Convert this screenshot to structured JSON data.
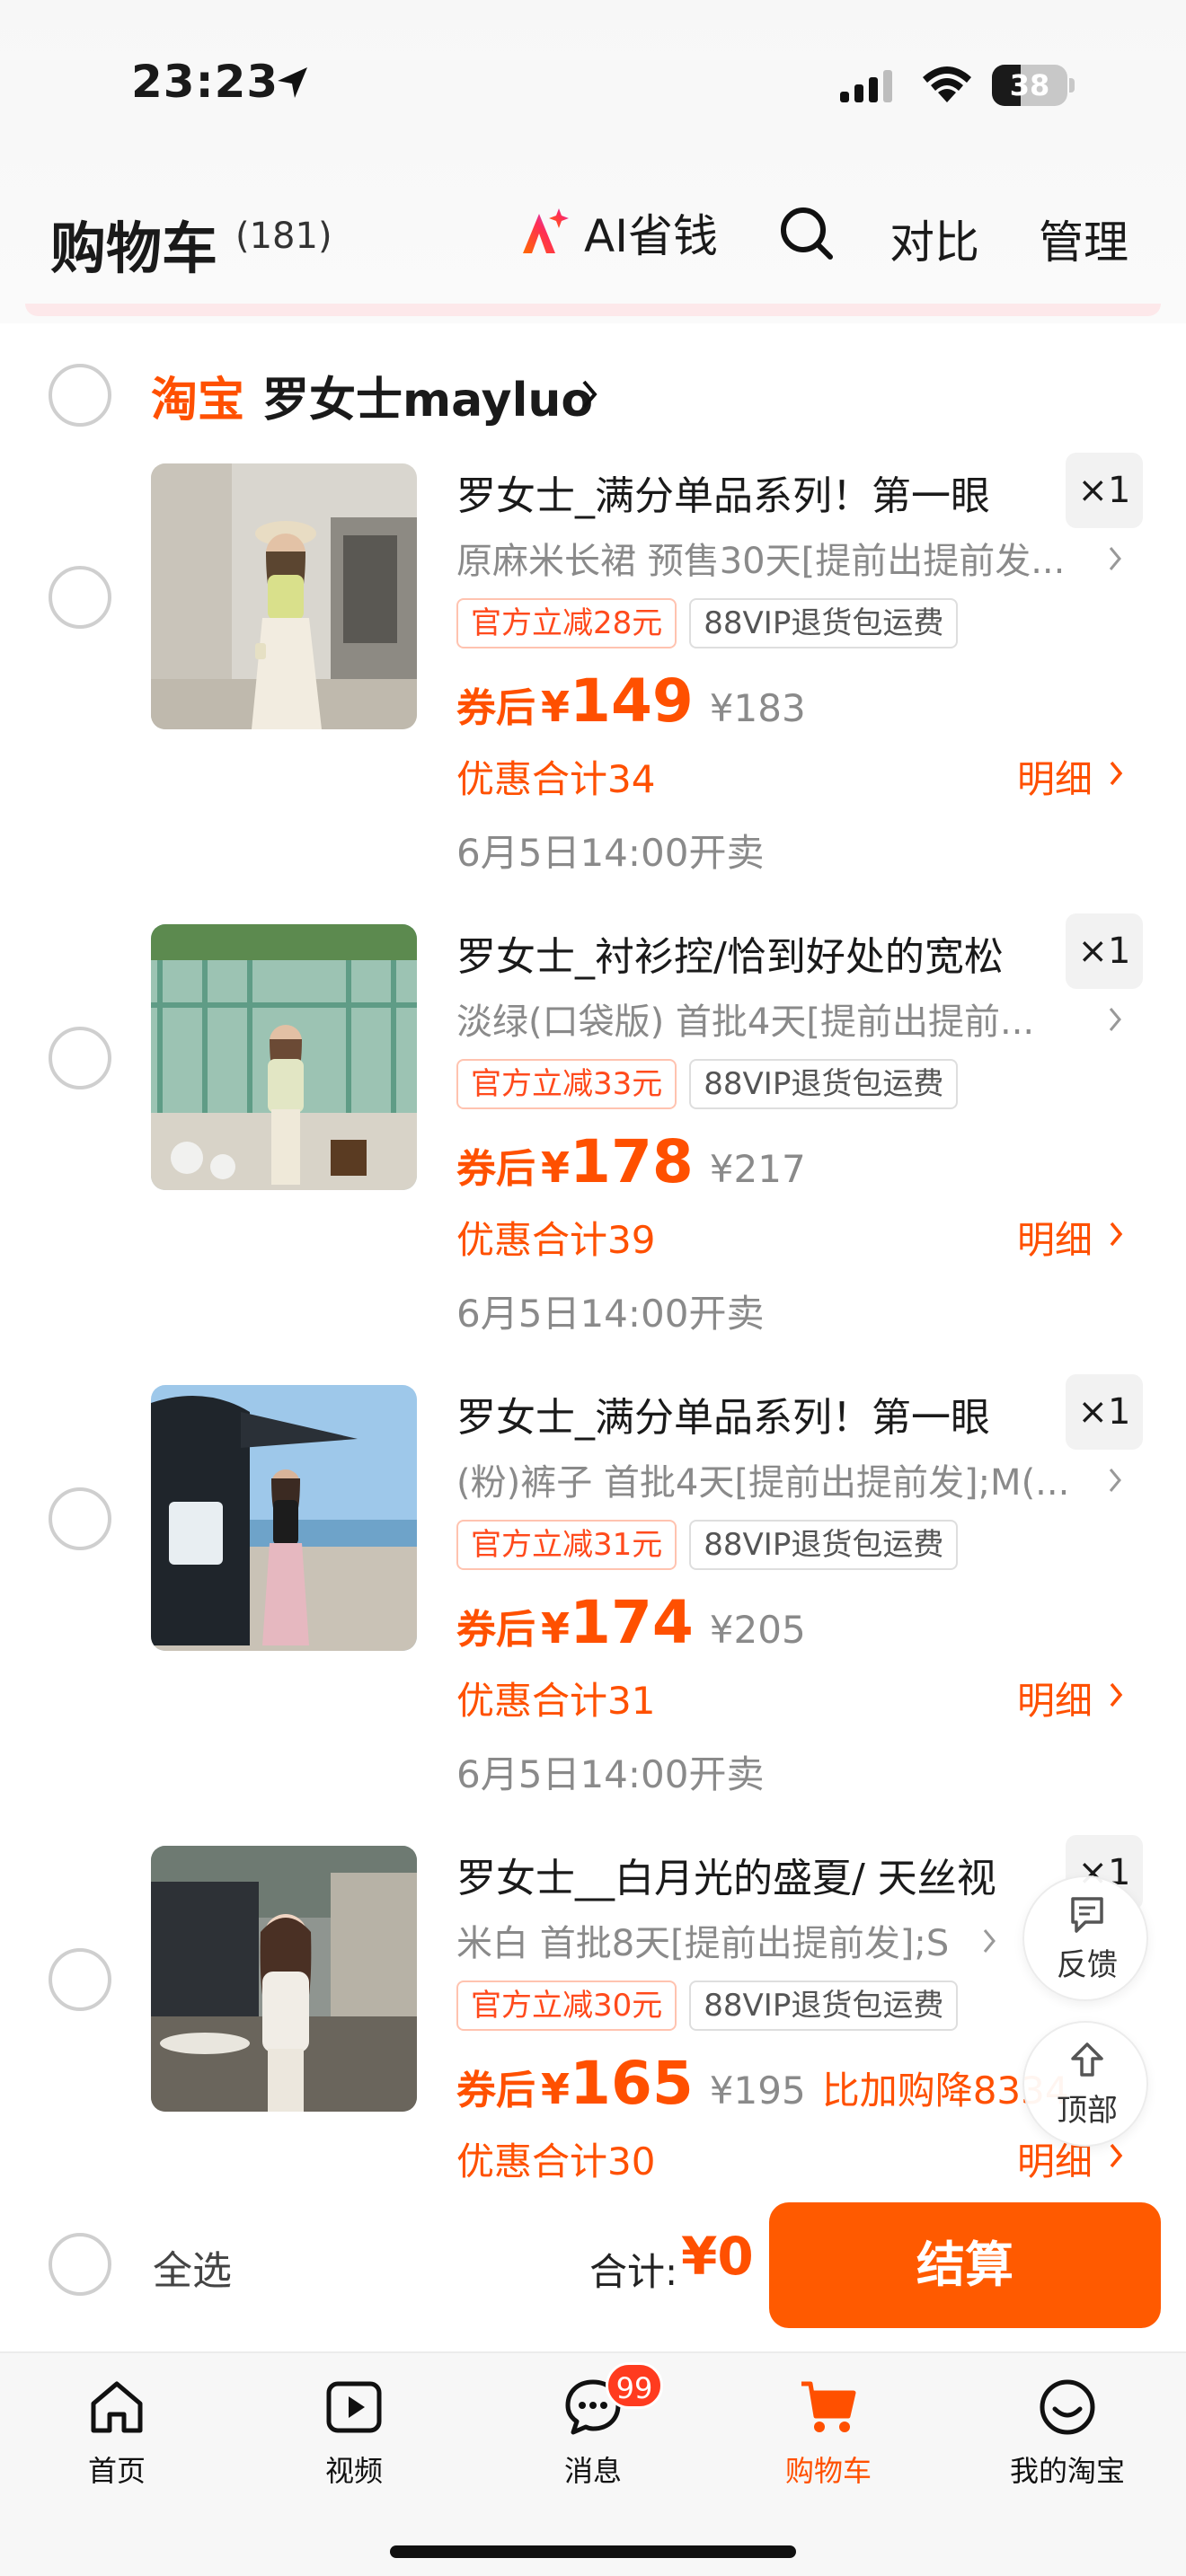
{
  "status_bar": {
    "time": "23:23",
    "battery": "38",
    "battery_level": 0.38
  },
  "header": {
    "title": "购物车",
    "count": "(181)",
    "ai_label": "AI省钱",
    "compare_label": "对比",
    "manage_label": "管理"
  },
  "shop": {
    "brand": "淘宝",
    "name": "罗女士mayluo"
  },
  "items": [
    {
      "title": "罗女士_满分单品系列！第一眼",
      "qty": "×1",
      "sku": "原麻米长裙 预售30天[提前出提前发...",
      "tag1": "官方立减28元",
      "tag2": "88VIP退货包运费",
      "price_prefix": "券后",
      "yen": "¥",
      "price": "149",
      "orig_price": "¥183",
      "extra": "",
      "discount": "优惠合计34",
      "detail": "明细",
      "sale_date": "6月5日14:00开卖"
    },
    {
      "title": "罗女士_衬衫控/恰到好处的宽松",
      "qty": "×1",
      "sku": "淡绿(口袋版) 首批4天[提前出提前...",
      "tag1": "官方立减33元",
      "tag2": "88VIP退货包运费",
      "price_prefix": "券后",
      "yen": "¥",
      "price": "178",
      "orig_price": "¥217",
      "extra": "",
      "discount": "优惠合计39",
      "detail": "明细",
      "sale_date": "6月5日14:00开卖"
    },
    {
      "title": "罗女士_满分单品系列！第一眼",
      "qty": "×1",
      "sku": "(粉)裤子 首批4天[提前出提前发];M(...",
      "tag1": "官方立减31元",
      "tag2": "88VIP退货包运费",
      "price_prefix": "券后",
      "yen": "¥",
      "price": "174",
      "orig_price": "¥205",
      "extra": "",
      "discount": "优惠合计31",
      "detail": "明细",
      "sale_date": "6月5日14:00开卖"
    },
    {
      "title": "罗女士__白月光的盛夏/ 天丝视",
      "qty": "×1",
      "sku": "米白 首批8天[提前出提前发];S",
      "tag1": "官方立减30元",
      "tag2": "88VIP退货包运费",
      "price_prefix": "券后",
      "yen": "¥",
      "price": "165",
      "orig_price": "¥195",
      "extra": "比加购降8334",
      "discount": "优惠合计30",
      "detail": "明细",
      "sale_date": ""
    }
  ],
  "floating": {
    "feedback": "反馈",
    "top": "顶部"
  },
  "settle": {
    "select_all": "全选",
    "total_label": "合计:",
    "total_value": "¥0",
    "checkout": "结算"
  },
  "tabs": [
    {
      "label": "首页",
      "icon": "home-icon"
    },
    {
      "label": "视频",
      "icon": "video-icon"
    },
    {
      "label": "消息",
      "icon": "message-icon",
      "badge": "99"
    },
    {
      "label": "购物车",
      "icon": "cart-icon",
      "active": true
    },
    {
      "label": "我的淘宝",
      "icon": "profile-icon"
    }
  ],
  "colors": {
    "accent": "#ff5000",
    "checkout": "#ff5a00",
    "badge": "#ff3b1f"
  }
}
